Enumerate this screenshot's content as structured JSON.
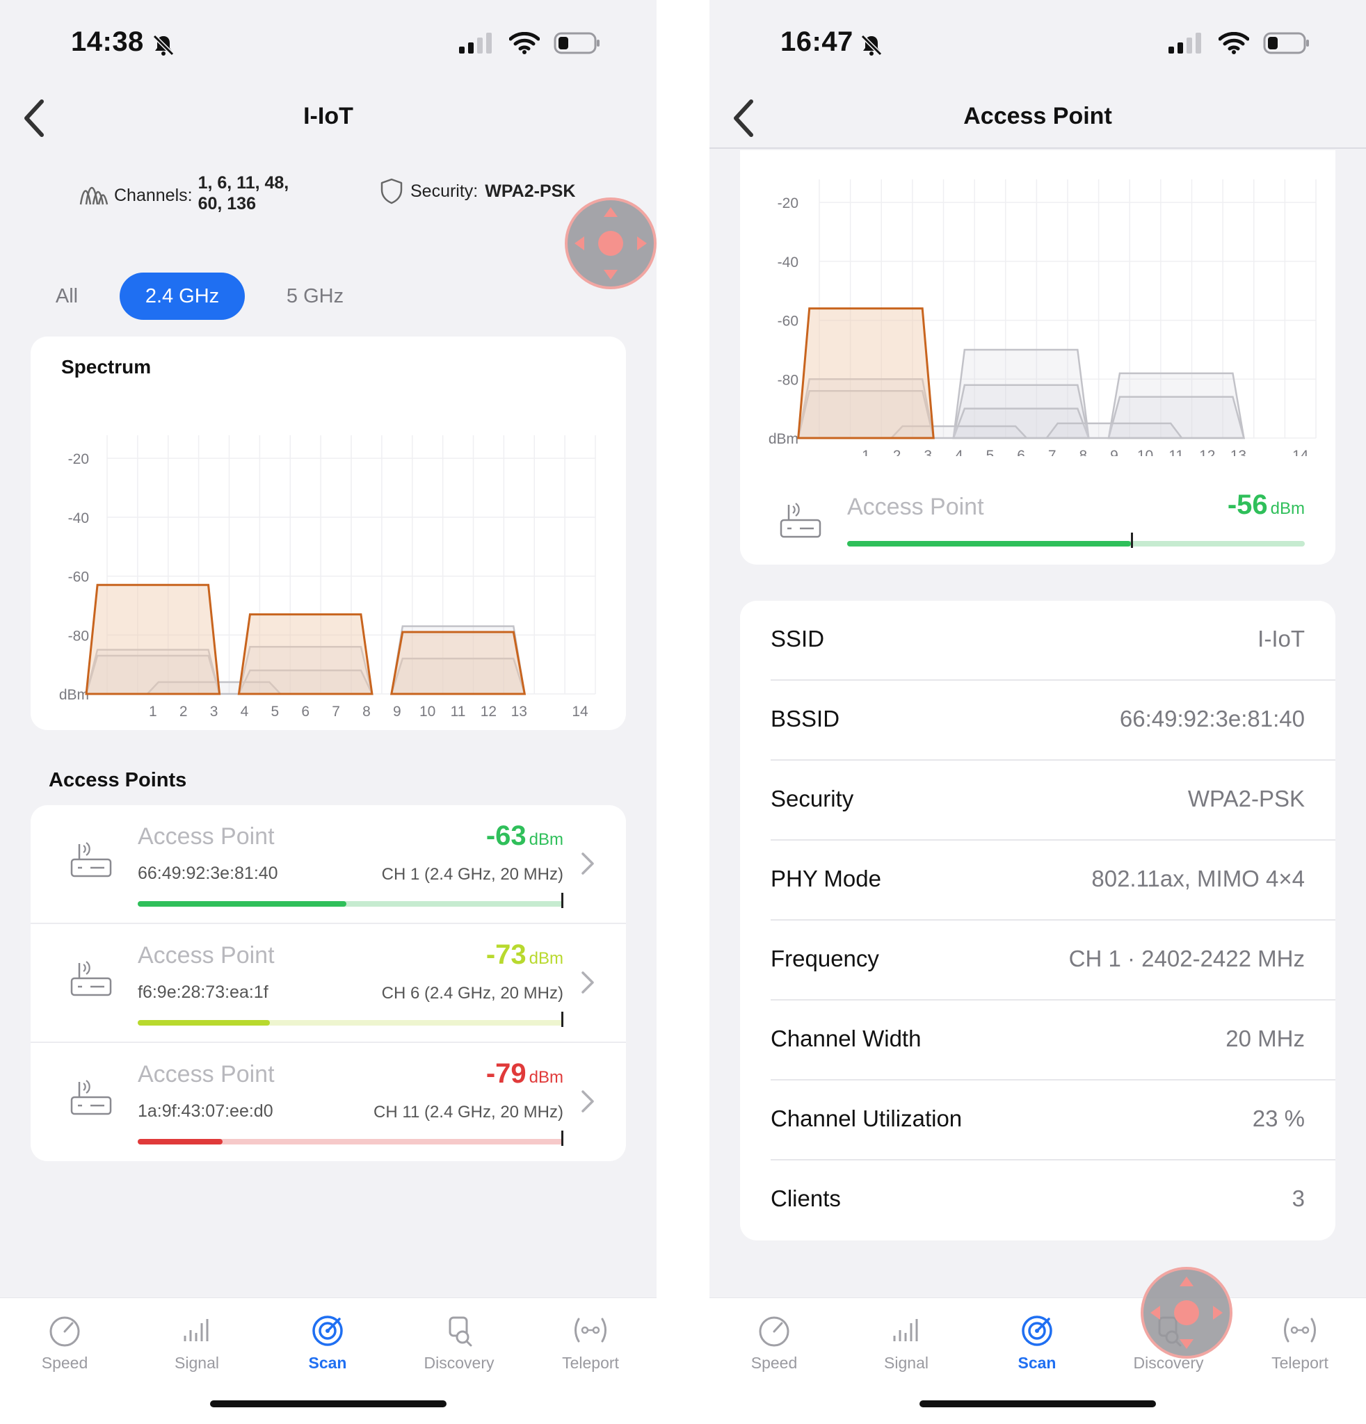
{
  "left": {
    "status": {
      "time": "14:38"
    },
    "nav": {
      "title": "I-IoT"
    },
    "info": {
      "channels_label": "Channels:",
      "channels_value": "1, 6, 11, 48, 60, 136",
      "security_label": "Security:",
      "security_value": "WPA2-PSK"
    },
    "bands": [
      "All",
      "2.4 GHz",
      "5 GHz"
    ],
    "active_band": "2.4 GHz",
    "spectrum_title": "Spectrum",
    "access_points_title": "Access Points",
    "access_points": [
      {
        "name": "Access Point",
        "bssid": "66:49:92:3e:81:40",
        "rssi": "-63",
        "unit": "dBm",
        "channel": "CH 1 (2.4 GHz, 20 MHz)",
        "color": "#2fbf5a",
        "light": "#c6ebd0",
        "level": 0.49
      },
      {
        "name": "Access Point",
        "bssid": "f6:9e:28:73:ea:1f",
        "rssi": "-73",
        "unit": "dBm",
        "channel": "CH 6 (2.4 GHz, 20 MHz)",
        "color": "#b8d92e",
        "light": "#eef5cf",
        "level": 0.31
      },
      {
        "name": "Access Point",
        "bssid": "1a:9f:43:07:ee:d0",
        "rssi": "-79",
        "unit": "dBm",
        "channel": "CH 11 (2.4 GHz, 20 MHz)",
        "color": "#e03a3a",
        "light": "#f6c9c9",
        "level": 0.2
      }
    ]
  },
  "right": {
    "status": {
      "time": "16:47"
    },
    "nav": {
      "title": "Access Point"
    },
    "ap": {
      "name": "Access Point",
      "rssi": "-56",
      "unit": "dBm",
      "color": "#2fbf5a",
      "light": "#c6ebd0",
      "level": 0.62
    },
    "details": [
      {
        "label": "SSID",
        "value": "I-IoT"
      },
      {
        "label": "BSSID",
        "value": "66:49:92:3e:81:40"
      },
      {
        "label": "Security",
        "value": "WPA2-PSK"
      },
      {
        "label": "PHY Mode",
        "value": "802.11ax, MIMO 4×4"
      },
      {
        "label": "Frequency",
        "value": "CH 1 · 2402-2422 MHz"
      },
      {
        "label": "Channel Width",
        "value": "20 MHz"
      },
      {
        "label": "Channel Utilization",
        "value": "23 %"
      },
      {
        "label": "Clients",
        "value": "3"
      }
    ]
  },
  "tabs": [
    "Speed",
    "Signal",
    "Scan",
    "Discovery",
    "Teleport"
  ],
  "active_tab": "Scan",
  "chart_data": [
    {
      "type": "area",
      "y_ticks": [
        "-20",
        "-40",
        "-60",
        "-80",
        "dBm"
      ],
      "x_ticks": [
        "1",
        "2",
        "3",
        "4",
        "5",
        "6",
        "7",
        "8",
        "9",
        "10",
        "11",
        "12",
        "13",
        "14"
      ],
      "ylim": [
        -100,
        -15
      ],
      "series": [
        {
          "channel": 1,
          "rssi": -63,
          "highlight": true
        },
        {
          "channel": 1,
          "rssi": -85,
          "highlight": false
        },
        {
          "channel": 1,
          "rssi": -87,
          "highlight": false
        },
        {
          "channel": 6,
          "rssi": -73,
          "highlight": true
        },
        {
          "channel": 6,
          "rssi": -84,
          "highlight": false
        },
        {
          "channel": 6,
          "rssi": -92,
          "highlight": false
        },
        {
          "channel": 11,
          "rssi": -79,
          "highlight": true
        },
        {
          "channel": 11,
          "rssi": -77,
          "highlight": false
        },
        {
          "channel": 11,
          "rssi": -88,
          "highlight": false
        },
        {
          "channel": 3,
          "rssi": -96,
          "highlight": false
        }
      ]
    },
    {
      "type": "area",
      "y_ticks": [
        "-20",
        "-40",
        "-60",
        "-80",
        "dBm"
      ],
      "x_ticks": [
        "1",
        "2",
        "3",
        "4",
        "5",
        "6",
        "7",
        "8",
        "9",
        "10",
        "11",
        "12",
        "13",
        "14"
      ],
      "ylim": [
        -100,
        -15
      ],
      "series": [
        {
          "channel": 1,
          "rssi": -56,
          "highlight": true
        },
        {
          "channel": 1,
          "rssi": -80,
          "highlight": false
        },
        {
          "channel": 1,
          "rssi": -84,
          "highlight": false
        },
        {
          "channel": 6,
          "rssi": -70,
          "highlight": false
        },
        {
          "channel": 6,
          "rssi": -82,
          "highlight": false
        },
        {
          "channel": 6,
          "rssi": -90,
          "highlight": false
        },
        {
          "channel": 11,
          "rssi": -78,
          "highlight": false
        },
        {
          "channel": 11,
          "rssi": -86,
          "highlight": false
        },
        {
          "channel": 4,
          "rssi": -96,
          "highlight": false
        },
        {
          "channel": 9,
          "rssi": -95,
          "highlight": false
        }
      ]
    }
  ]
}
